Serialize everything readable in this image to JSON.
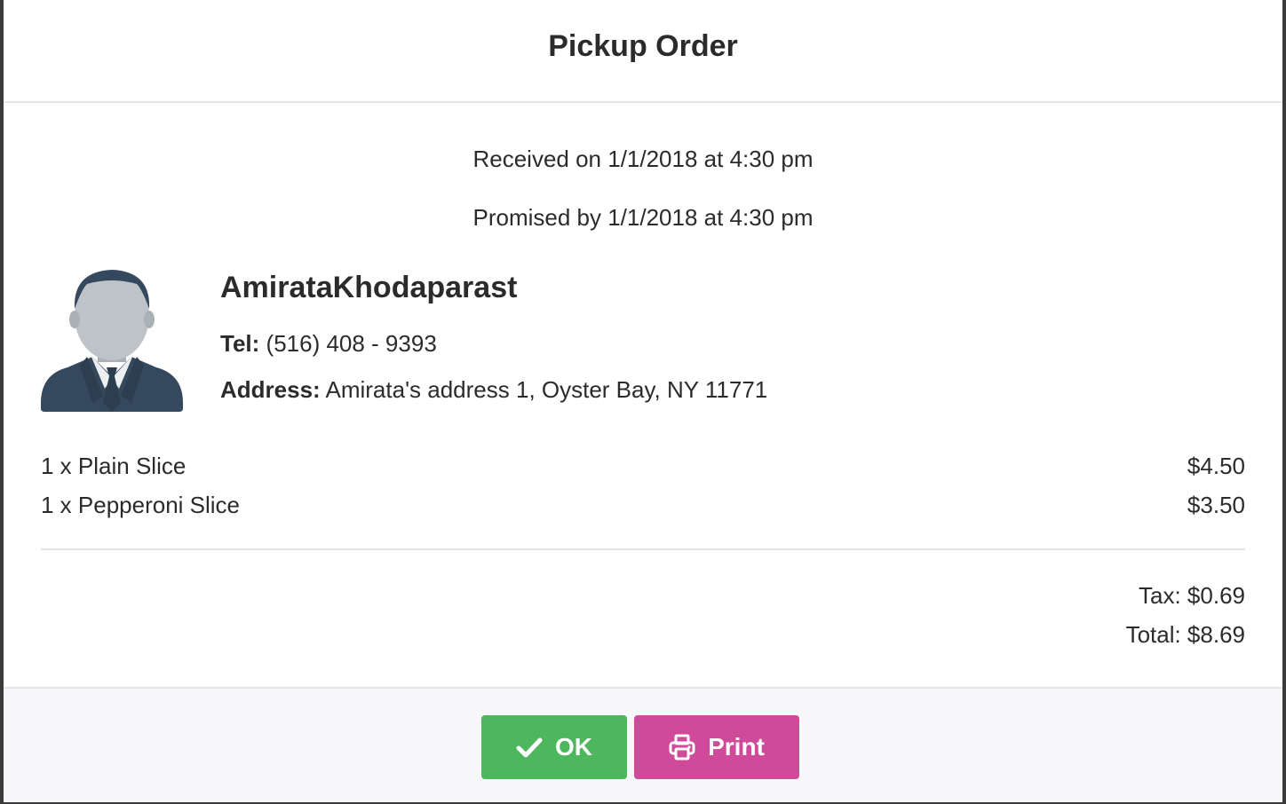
{
  "modal": {
    "title": "Pickup Order"
  },
  "order": {
    "received": "Received on 1/1/2018 at 4:30 pm",
    "promised": "Promised by 1/1/2018 at 4:30 pm"
  },
  "customer": {
    "name": "AmirataKhodaparast",
    "tel_label": "Tel:",
    "tel": "(516) 408 - 9393",
    "address_label": "Address:",
    "address": "Amirata's address 1, Oyster Bay, NY 11771",
    "avatar_icon": "person-avatar-icon"
  },
  "items": [
    {
      "name": "1 x Plain Slice",
      "price": "$4.50"
    },
    {
      "name": "1 x Pepperoni Slice",
      "price": "$3.50"
    }
  ],
  "totals": {
    "tax": "Tax: $0.69",
    "total": "Total: $8.69"
  },
  "footer": {
    "ok_label": "OK",
    "print_label": "Print",
    "ok_icon": "check-icon",
    "print_icon": "printer-icon"
  },
  "colors": {
    "ok_button": "#4cb75c",
    "print_button": "#d04a9a"
  }
}
